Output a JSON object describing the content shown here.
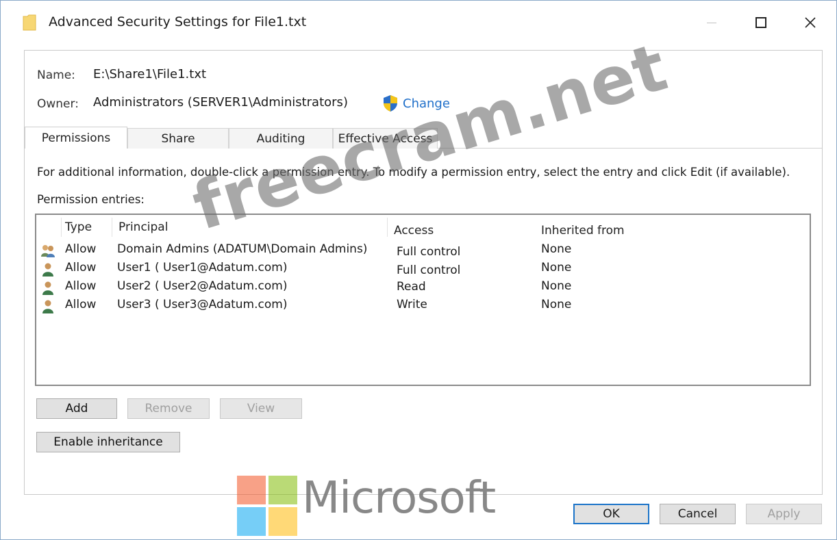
{
  "window": {
    "title": "Advanced Security Settings for File1.txt",
    "icon": "folder-icon",
    "controls": [
      "minimize-icon",
      "maximize-icon",
      "close-icon"
    ]
  },
  "header": {
    "name_label": "Name:",
    "name_value": "E:\\Share1\\File1.txt",
    "owner_label": "Owner:",
    "owner_value": "Administrators (SERVER1\\Administrators)",
    "change_label": "Change",
    "change_icon": "uac-shield-icon"
  },
  "tabs": [
    {
      "label": "Permissions",
      "active": true
    },
    {
      "label": "Share",
      "active": false
    },
    {
      "label": "Auditing",
      "active": false
    },
    {
      "label": "Effective Access",
      "active": false
    }
  ],
  "permissions": {
    "info_text": "For additional information, double-click a permission entry. To modify a permission entry, select the entry and click Edit (if available).",
    "entries_label": "Permission entries:",
    "columns": {
      "type": "Type",
      "principal": "Principal",
      "access": "Access",
      "inherited": "Inherited from"
    },
    "rows": [
      {
        "icon": "group-icon",
        "type": "Allow",
        "principal": "Domain Admins (ADATUM\\Domain Admins)",
        "access": "Full control",
        "inherited": "None"
      },
      {
        "icon": "user-icon",
        "type": "Allow",
        "principal": "User1 ( User1@Adatum.com)",
        "access": "Full control",
        "inherited": "None"
      },
      {
        "icon": "user-icon",
        "type": "Allow",
        "principal": "User2 ( User2@Adatum.com)",
        "access": "Read",
        "inherited": "None"
      },
      {
        "icon": "user-icon",
        "type": "Allow",
        "principal": "User3 ( User3@Adatum.com)",
        "access": "Write",
        "inherited": "None"
      }
    ],
    "buttons": {
      "add": "Add",
      "remove": "Remove",
      "view": "View",
      "enable_inheritance": "Enable inheritance"
    }
  },
  "footer": {
    "ok": "OK",
    "cancel": "Cancel",
    "apply": "Apply"
  },
  "overlays": {
    "watermark": "freecram.net",
    "brand_text": "Microsoft"
  },
  "colors": {
    "accent": "#1b74c9",
    "link": "#1f6fc9",
    "ms_red": "#f35325",
    "ms_green": "#81bc06",
    "ms_blue": "#05a6f0",
    "ms_yellow": "#ffba08"
  }
}
